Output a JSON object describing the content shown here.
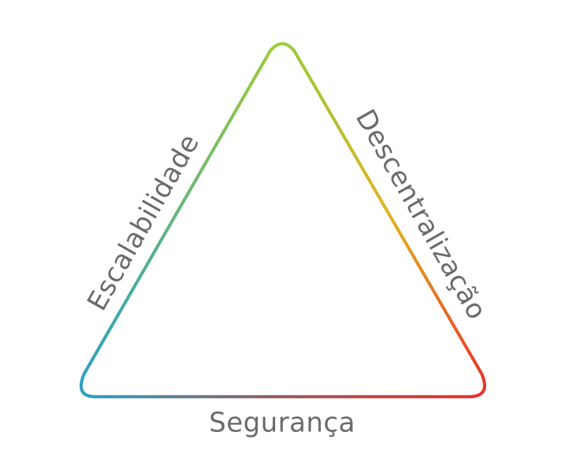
{
  "diagram": {
    "labels": {
      "left": "Escalabilidade",
      "right": "Descentralização",
      "bottom": "Segurança"
    },
    "colors": {
      "apex": "#9ccb3b",
      "bottom_left": "#2aa0c4",
      "bottom_right": "#e8322a",
      "right_middle": "#e2b21f",
      "bottom_middle": "#9a5a5e",
      "label_text": "#6b6b6b"
    }
  }
}
